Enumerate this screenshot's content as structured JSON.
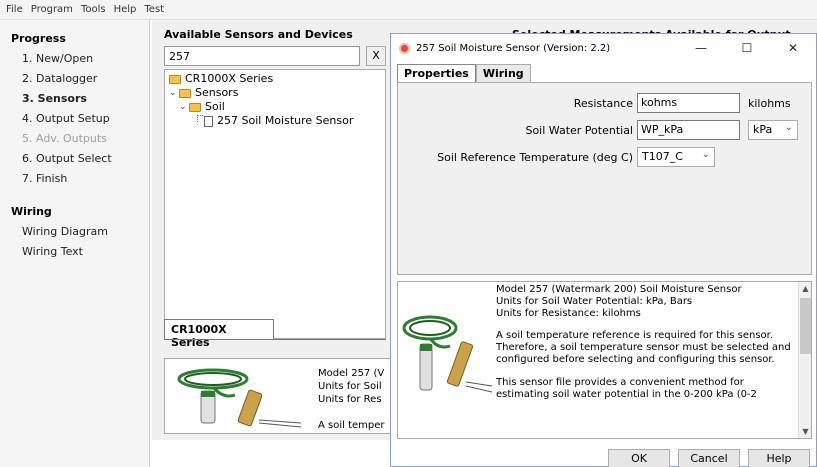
{
  "menu": [
    "File",
    "Program",
    "Tools",
    "Help",
    "Test"
  ],
  "progress": {
    "title": "Progress",
    "items": [
      {
        "label": "1. New/Open",
        "state": "normal"
      },
      {
        "label": "2. Datalogger",
        "state": "normal"
      },
      {
        "label": "3. Sensors",
        "state": "active"
      },
      {
        "label": "4. Output Setup",
        "state": "normal"
      },
      {
        "label": "5. Adv. Outputs",
        "state": "disabled"
      },
      {
        "label": "6. Output Select",
        "state": "normal"
      },
      {
        "label": "7. Finish",
        "state": "normal"
      }
    ]
  },
  "wiring": {
    "title": "Wiring",
    "items": [
      "Wiring Diagram",
      "Wiring Text"
    ]
  },
  "sensors_panel": {
    "title": "Available Sensors and Devices",
    "right_title": "Selected Measurements Available for Output",
    "search_value": "257",
    "clear_label": "X",
    "tree": {
      "root": "CR1000X Series",
      "sensors": "Sensors",
      "soil": "Soil",
      "item": "257 Soil Moisture Sensor"
    },
    "tab_label": "CR1000X Series",
    "info_lines": [
      "Model 257 (V",
      "Units for Soil",
      "Units for Res",
      "",
      "A soil temper"
    ]
  },
  "dialog": {
    "title": "257 Soil Moisture Sensor (Version: 2.2)",
    "win_buttons": [
      "—",
      "☐",
      "✕"
    ],
    "tabs": [
      "Properties",
      "Wiring"
    ],
    "fields": {
      "resistance_label": "Resistance",
      "resistance_value": "kohms",
      "resistance_unit": "kilohms",
      "swp_label": "Soil Water Potential",
      "swp_value": "WP_kPa",
      "swp_unit": "kPa",
      "temp_label": "Soil Reference Temperature (deg C)",
      "temp_value": "T107_C"
    },
    "description": [
      "Model 257 (Watermark 200) Soil Moisture Sensor\nUnits for Soil Water Potential: kPa, Bars\nUnits for Resistance: kilohms",
      "A soil temperature reference is required for this sensor. Therefore, a soil temperature sensor must be selected and configured before selecting and configuring this sensor.",
      "This sensor file provides a convenient method for estimating soil water potential in the 0-200 kPa (0-2"
    ],
    "buttons": {
      "ok": "OK",
      "cancel": "Cancel",
      "help": "Help"
    }
  }
}
